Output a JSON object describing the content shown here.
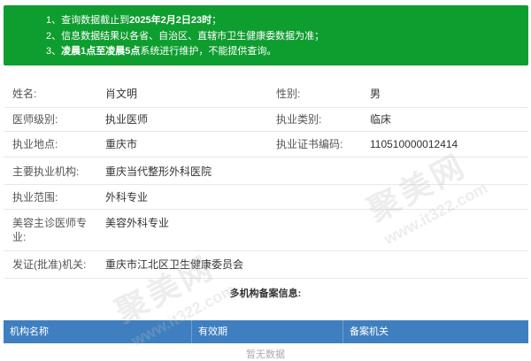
{
  "notice": {
    "line1_prefix": "1、查询数据截止到",
    "line1_bold": "2025年2月2日23时",
    "line1_suffix": "；",
    "line2": "2、信息数据结果以各省、自治区、直辖市卫生健康委数据为准；",
    "line3_prefix": "3、",
    "line3_bold": "凌晨1点至凌晨5点",
    "line3_suffix": "系统进行维护，不能提供查询。"
  },
  "info": {
    "name_label": "姓名:",
    "name_value": "肖文明",
    "gender_label": "性别:",
    "gender_value": "男",
    "level_label": "医师级别:",
    "level_value": "执业医师",
    "category_label": "执业类别:",
    "category_value": "临床",
    "location_label": "执业地点:",
    "location_value": "重庆市",
    "cert_label": "执业证书编码:",
    "cert_value": "110510000012414",
    "institution_label": "主要执业机构:",
    "institution_value": "重庆当代整形外科医院",
    "scope_label": "执业范围:",
    "scope_value": "外科专业",
    "cosmetic_label_line1": "美容主诊医师专",
    "cosmetic_label_line2": "业:",
    "cosmetic_value": "美容外科专业",
    "issuer_label": "发证(批准)机关:",
    "issuer_value": "重庆市江北区卫生健康委员会"
  },
  "multi": {
    "heading": "多机构备案信息:",
    "columns": [
      "机构名称",
      "有效期",
      "备案机关"
    ],
    "empty_text": "暂无数据"
  },
  "watermark": {
    "text": "聚美网",
    "url": "www.it322.com"
  }
}
